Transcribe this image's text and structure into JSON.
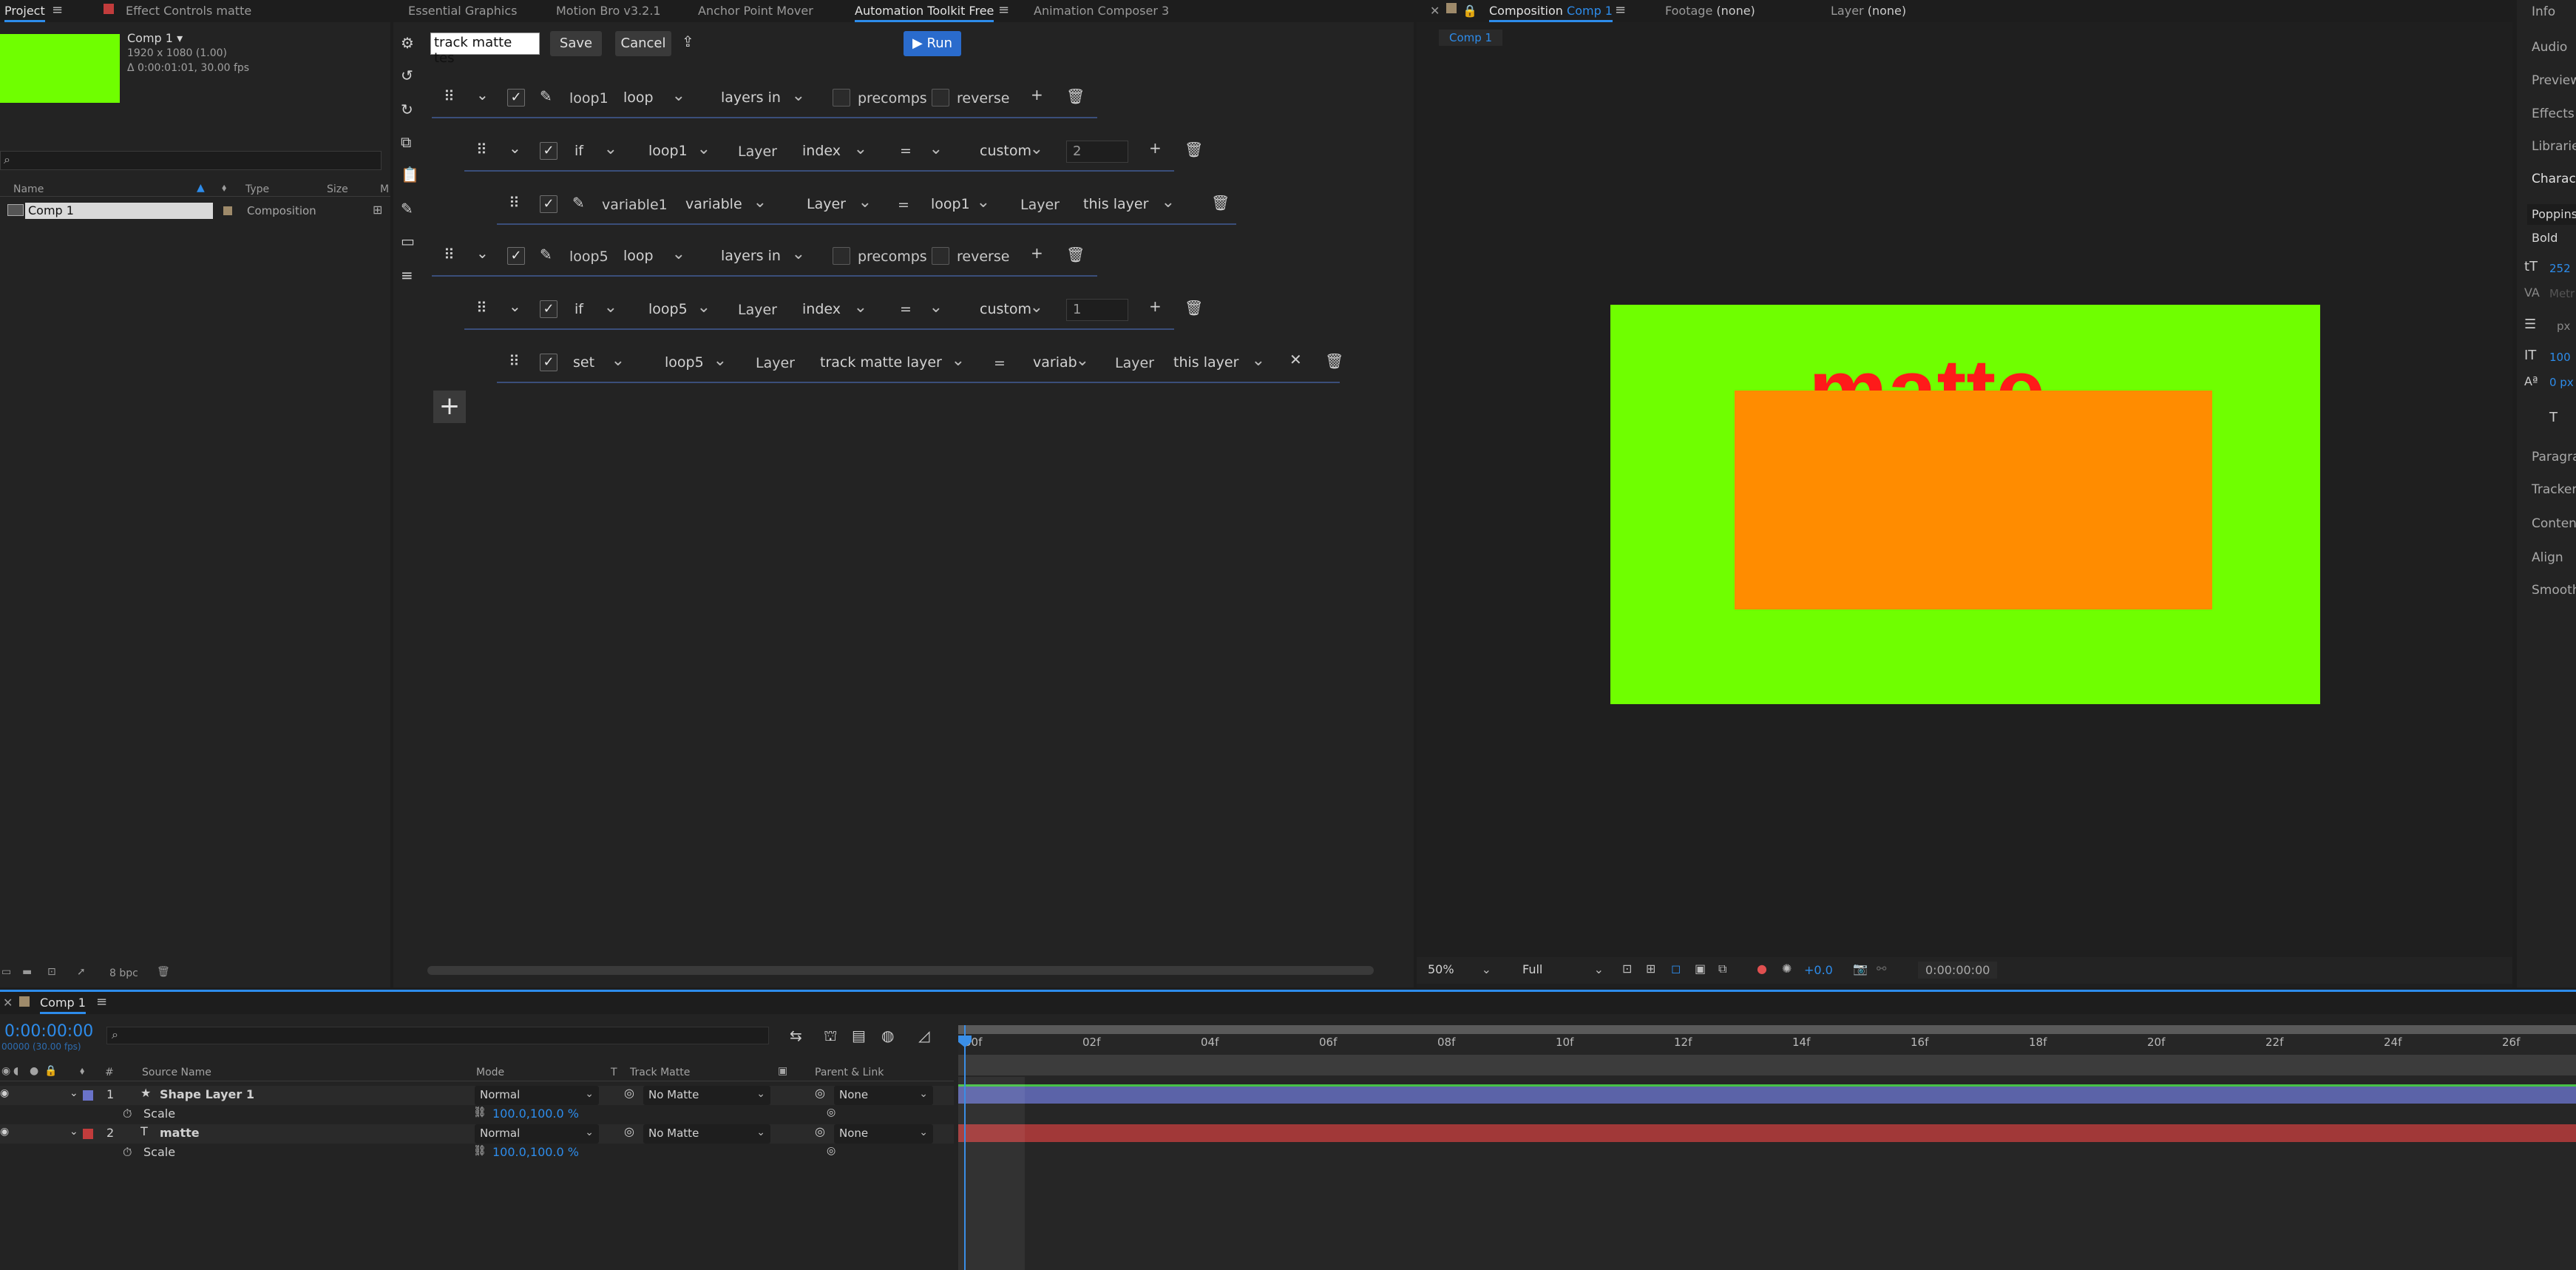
{
  "project_panel": {
    "tabs": [
      "Project",
      "Effect Controls"
    ],
    "effect_controls_target": "matte",
    "item_name": "Comp 1",
    "item_info": [
      "1920 x 1080 (1.00)",
      "Δ 0:00:01:01, 30.00 fps"
    ],
    "search_placeholder": "",
    "columns": [
      "Name",
      "Type",
      "Size",
      "M"
    ],
    "items": [
      {
        "name": "Comp 1",
        "type": "Composition"
      }
    ],
    "bpc": "8 bpc",
    "thumb_color": "#6fff00"
  },
  "toolkit_panel": {
    "tabs": [
      "Essential Graphics",
      "Motion Bro v3.2.1",
      "Anchor Point Mover",
      "Automation Toolkit Free",
      "Animation Composer 3"
    ],
    "active_tab": "Automation Toolkit Free",
    "script_name": "track matte tes",
    "save_label": "Save",
    "cancel_label": "Cancel",
    "run_label": "▶ Run",
    "rows": [
      {
        "name": "loop1",
        "mode": "loop",
        "range": "layers in",
        "precomps": "precomps",
        "reverse": "reverse"
      },
      {
        "kw": "if",
        "ref": "loop1",
        "layer": "Layer",
        "prop": "index",
        "op": "=",
        "val": "custom",
        "num": "2"
      },
      {
        "name": "variable1",
        "kind": "variable",
        "layer": "Layer",
        "op": "=",
        "ref": "loop1",
        "layer2": "Layer",
        "target": "this layer"
      },
      {
        "name": "loop5",
        "mode": "loop",
        "range": "layers in",
        "precomps": "precomps",
        "reverse": "reverse"
      },
      {
        "kw": "if",
        "ref": "loop5",
        "layer": "Layer",
        "prop": "index",
        "op": "=",
        "val": "custom",
        "num": "1"
      },
      {
        "kw": "set",
        "ref": "loop5",
        "layer": "Layer",
        "prop": "track matte layer",
        "op": "=",
        "val": "variab",
        "layer2": "Layer",
        "target": "this layer"
      }
    ],
    "add_symbol": "+"
  },
  "comp_panel": {
    "tabs": [
      {
        "label": "Composition",
        "sub": "Comp 1"
      },
      {
        "label": "Footage",
        "sub": "(none)"
      },
      {
        "label": "Layer",
        "sub": "(none)"
      }
    ],
    "breadcrumb": "Comp 1",
    "canvas_bg": "#6fff00",
    "text_layer": "matte",
    "text_color": "#ff1a1a",
    "shape_color": "#ff8c00",
    "zoom": "50%",
    "resolution": "Full",
    "exposure": "+0.0",
    "timecode": "0:00:00:00"
  },
  "right_panel": {
    "items": [
      "Info",
      "Audio",
      "Preview",
      "Effects &",
      "Libraries",
      "Characte"
    ],
    "font_name": "Poppins",
    "font_style": "Bold",
    "font_size": "252",
    "kerning": "Metr",
    "leading": "px",
    "vscale": "100",
    "baseline": "0 px",
    "lower_items": [
      "Paragra",
      "Tracker",
      "Content",
      "Align",
      "Smooth"
    ]
  },
  "timeline": {
    "tab": "Comp 1",
    "timecode": "0:00:00:00",
    "frames": "00000 (30.00 fps)",
    "columns": [
      "Source Name",
      "Mode",
      "T",
      "Track Matte",
      "Parent & Link"
    ],
    "layers": [
      {
        "num": "1",
        "name": "Shape Layer 1",
        "mode": "Normal",
        "matte": "No Matte",
        "parent": "None",
        "color": "#6a73c9",
        "prop": "Scale",
        "value": "100.0,100.0 %"
      },
      {
        "num": "2",
        "name": "matte",
        "mode": "Normal",
        "matte": "No Matte",
        "parent": "None",
        "color": "#c23c3c",
        "prop": "Scale",
        "value": "100.0,100.0 %"
      }
    ],
    "ruler": [
      "00f",
      "02f",
      "04f",
      "06f",
      "08f",
      "10f",
      "12f",
      "14f",
      "16f",
      "18f",
      "20f",
      "22f",
      "24f",
      "26f"
    ]
  }
}
